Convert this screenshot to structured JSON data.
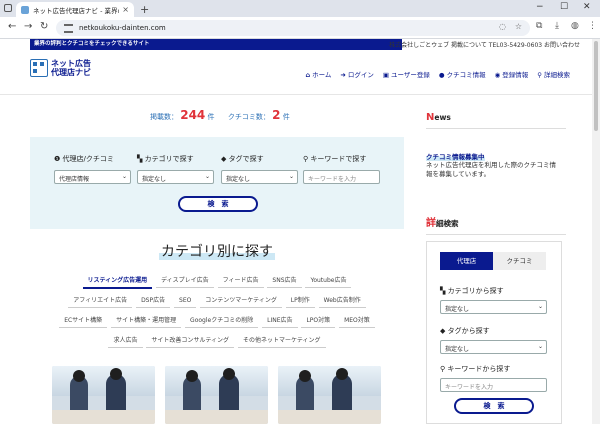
{
  "browser": {
    "tab_title": "ネット広告代理店ナビ - 業界の評",
    "tab_close": "×",
    "new_tab": "+",
    "url": "netkoukoku-dainten.com",
    "window": {
      "minimize": "−",
      "maximize": "☐",
      "close": "✕"
    }
  },
  "site": {
    "tagline": "業界の評判とクチコミをチェックできるサイト",
    "top_links": "株式会社しごとウェブ  掲載について  TEL03-5429-0603  お問い合わせ",
    "logo_line1": "ネット広告",
    "logo_line2": "代理店ナビ",
    "nav": [
      {
        "icon": "home-icon",
        "glyph": "⌂",
        "label": "ホーム"
      },
      {
        "icon": "login-icon",
        "glyph": "➜",
        "label": "ログイン"
      },
      {
        "icon": "user-register-icon",
        "glyph": "▣",
        "label": "ユーザー登録"
      },
      {
        "icon": "comment-icon",
        "glyph": "●",
        "label": "クチコミ情報"
      },
      {
        "icon": "globe-icon",
        "glyph": "◉",
        "label": "登録情報"
      },
      {
        "icon": "search-icon",
        "glyph": "⚲",
        "label": "詳細検索"
      }
    ]
  },
  "counts": {
    "listed_label": "掲載数：",
    "listed_value": "244",
    "listed_unit": "件",
    "reviews_label": "クチコミ数：",
    "reviews_value": "2",
    "reviews_unit": "件"
  },
  "search": {
    "col1_label": "代理店/クチコミ",
    "col1_value": "代理店情報",
    "col2_label": "カテゴリで探す",
    "col2_value": "指定なし",
    "col3_label": "タグで探す",
    "col3_value": "指定なし",
    "col4_label": "キーワードで探す",
    "col4_placeholder": "キーワードを入力",
    "button": "検　索"
  },
  "category": {
    "title": "カテゴリ別に探す",
    "rows": [
      [
        "リスティング広告運用",
        "ディスプレイ広告",
        "フィード広告",
        "SNS広告",
        "Youtube広告"
      ],
      [
        "アフィリエイト広告",
        "DSP広告",
        "SEO",
        "コンテンツマーケティング",
        "LP制作",
        "Web広告制作"
      ],
      [
        "ECサイト構築",
        "サイト構築・運用管理",
        "Googleクチコミの削除",
        "LINE広告",
        "LPO対策",
        "MEO対策"
      ],
      [
        "求人広告",
        "サイト改善コンサルティング",
        "その他ネットマーケティング"
      ]
    ],
    "active": "リスティング広告運用"
  },
  "sidebar": {
    "news_first": "N",
    "news_rest": "ews",
    "news_title": "クチコミ情報募集中",
    "news_body": "ネット広告代理店を利用した際のクチコミ情報を募集しています。",
    "detail_first": "詳",
    "detail_rest": "細検索",
    "tab_agency": "代理店",
    "tab_review": "クチコミ",
    "cat_label": "カテゴリから探す",
    "cat_value": "指定なし",
    "tag_label": "タグから探す",
    "tag_value": "指定なし",
    "kw_label": "キーワードから探す",
    "kw_placeholder": "キーワードを入力",
    "button": "検　索"
  },
  "colors": {
    "brand_navy": "#0a1a8f",
    "accent_red": "#e0333a",
    "panel_bg": "#e8f4f8"
  }
}
